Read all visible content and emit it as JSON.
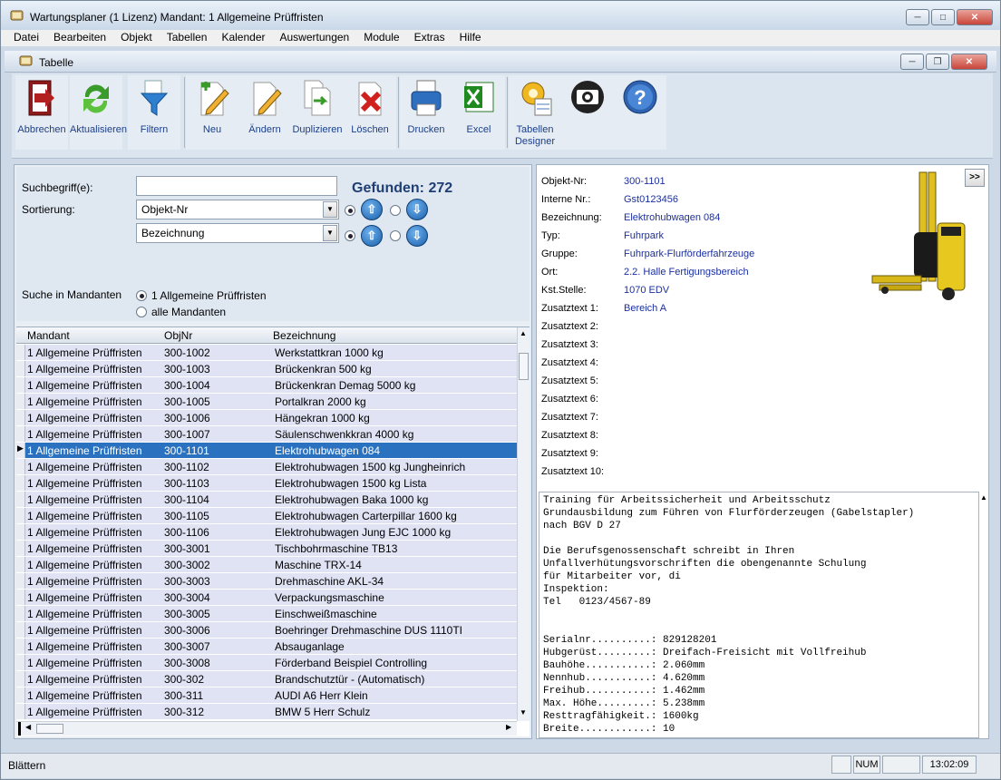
{
  "window": {
    "title": "Wartungsplaner  (1 Lizenz)    Mandant: 1 Allgemeine Prüffristen"
  },
  "menu": [
    "Datei",
    "Bearbeiten",
    "Objekt",
    "Tabellen",
    "Kalender",
    "Auswertungen",
    "Module",
    "Extras",
    "Hilfe"
  ],
  "child_window": {
    "title": "Tabelle"
  },
  "toolbar": {
    "buttons": [
      {
        "label": "Abbrechen",
        "icon": "exit-icon"
      },
      {
        "label": "Aktualisieren",
        "icon": "refresh-icon"
      },
      {
        "label": "Filtern",
        "icon": "filter-icon"
      },
      {
        "label": "Neu",
        "icon": "new-icon"
      },
      {
        "label": "Ändern",
        "icon": "edit-icon"
      },
      {
        "label": "Duplizieren",
        "icon": "duplicate-icon"
      },
      {
        "label": "Löschen",
        "icon": "delete-icon"
      },
      {
        "label": "Drucken",
        "icon": "printer-icon"
      },
      {
        "label": "Excel",
        "icon": "excel-icon"
      },
      {
        "label": "Tabellen Designer",
        "icon": "designer-icon"
      },
      {
        "label": "",
        "icon": "camera-icon"
      },
      {
        "label": "",
        "icon": "help-icon"
      }
    ]
  },
  "search": {
    "search_label": "Suchbegriff(e):",
    "search_value": "",
    "found": "Gefunden: 272",
    "sort_label": "Sortierung:",
    "sort1": "Objekt-Nr",
    "sort2": "Bezeichnung",
    "mandant_label": "Suche in Mandanten",
    "mandant_opt1": "1 Allgemeine Prüffristen",
    "mandant_opt2": "alle Mandanten"
  },
  "grid": {
    "headers": [
      "Mandant",
      "ObjNr",
      "Bezeichnung"
    ],
    "rows": [
      [
        "1 Allgemeine Prüffristen",
        "300-1002",
        "Werkstattkran 1000 kg"
      ],
      [
        "1 Allgemeine Prüffristen",
        "300-1003",
        "Brückenkran 500 kg"
      ],
      [
        "1 Allgemeine Prüffristen",
        "300-1004",
        "Brückenkran Demag 5000 kg"
      ],
      [
        "1 Allgemeine Prüffristen",
        "300-1005",
        "Portalkran 2000 kg"
      ],
      [
        "1 Allgemeine Prüffristen",
        "300-1006",
        "Hängekran 1000 kg"
      ],
      [
        "1 Allgemeine Prüffristen",
        "300-1007",
        "Säulenschwenkkran 4000 kg"
      ],
      [
        "1 Allgemeine Prüffristen",
        "300-1101",
        "Elektrohubwagen 084"
      ],
      [
        "1 Allgemeine Prüffristen",
        "300-1102",
        "Elektrohubwagen 1500 kg  Jungheinrich"
      ],
      [
        "1 Allgemeine Prüffristen",
        "300-1103",
        "Elektrohubwagen 1500 kg Lista"
      ],
      [
        "1 Allgemeine Prüffristen",
        "300-1104",
        "Elektrohubwagen Baka 1000 kg"
      ],
      [
        "1 Allgemeine Prüffristen",
        "300-1105",
        "Elektrohubwagen Carterpillar 1600 kg"
      ],
      [
        "1 Allgemeine Prüffristen",
        "300-1106",
        "Elektrohubwagen Jung EJC 1000 kg"
      ],
      [
        "1 Allgemeine Prüffristen",
        "300-3001",
        "Tischbohrmaschine TB13"
      ],
      [
        "1 Allgemeine Prüffristen",
        "300-3002",
        "Maschine TRX-14"
      ],
      [
        "1 Allgemeine Prüffristen",
        "300-3003",
        "Drehmaschine AKL-34"
      ],
      [
        "1 Allgemeine Prüffristen",
        "300-3004",
        "Verpackungsmaschine"
      ],
      [
        "1 Allgemeine Prüffristen",
        "300-3005",
        "Einschweißmaschine"
      ],
      [
        "1 Allgemeine Prüffristen",
        "300-3006",
        "Boehringer Drehmaschine DUS 1110TI"
      ],
      [
        "1 Allgemeine Prüffristen",
        "300-3007",
        "Absauganlage"
      ],
      [
        "1 Allgemeine Prüffristen",
        "300-3008",
        "Förderband Beispiel Controlling"
      ],
      [
        "1 Allgemeine Prüffristen",
        "300-302",
        "Brandschutztür - (Automatisch)"
      ],
      [
        "1 Allgemeine Prüffristen",
        "300-311",
        "AUDI A6 Herr Klein"
      ],
      [
        "1 Allgemeine Prüffristen",
        "300-312",
        "BMW 5 Herr Schulz"
      ]
    ],
    "selected_index": 6
  },
  "detail": {
    "fields": [
      {
        "label": "Objekt-Nr:",
        "value": "300-1101"
      },
      {
        "label": "Interne Nr.:",
        "value": "Gst0123456"
      },
      {
        "label": "Bezeichnung:",
        "value": "Elektrohubwagen 084"
      },
      {
        "label": "Typ:",
        "value": "Fuhrpark"
      },
      {
        "label": "Gruppe:",
        "value": "Fuhrpark-Flurförderfahrzeuge"
      },
      {
        "label": "Ort:",
        "value": "2.2. Halle Fertigungsbereich"
      },
      {
        "label": "Kst.Stelle:",
        "value": "1070 EDV"
      },
      {
        "label": "Zusatztext 1:",
        "value": "Bereich A"
      },
      {
        "label": "Zusatztext 2:",
        "value": ""
      },
      {
        "label": "Zusatztext 3:",
        "value": ""
      },
      {
        "label": "Zusatztext 4:",
        "value": ""
      },
      {
        "label": "Zusatztext 5:",
        "value": ""
      },
      {
        "label": "Zusatztext 6:",
        "value": ""
      },
      {
        "label": "Zusatztext 7:",
        "value": ""
      },
      {
        "label": "Zusatztext 8:",
        "value": ""
      },
      {
        "label": "Zusatztext 9:",
        "value": ""
      },
      {
        "label": "Zusatztext 10:",
        "value": ""
      }
    ],
    "expand_label": ">>",
    "memo": "Training für Arbeitssicherheit und Arbeitsschutz\nGrundausbildung zum Führen von Flurförderzeugen (Gabelstapler)\nnach BGV D 27\n\nDie Berufsgenossenschaft schreibt in Ihren\nUnfallverhütungsvorschriften die obengenannte Schulung\nfür Mitarbeiter vor, di\nInspektion:\nTel   0123/4567-89\n\n\nSerialnr..........: 829128201\nHubgerüst.........: Dreifach-Freisicht mit Vollfreihub\nBauhöhe...........: 2.060mm\nNennhub...........: 4.620mm\nFreihub...........: 1.462mm\nMax. Höhe.........: 5.238mm\nResttragfähigkeit.: 1600kg\nBreite............: 10"
  },
  "status": {
    "text": "Blättern",
    "num": "NUM",
    "time": "13:02:09"
  }
}
